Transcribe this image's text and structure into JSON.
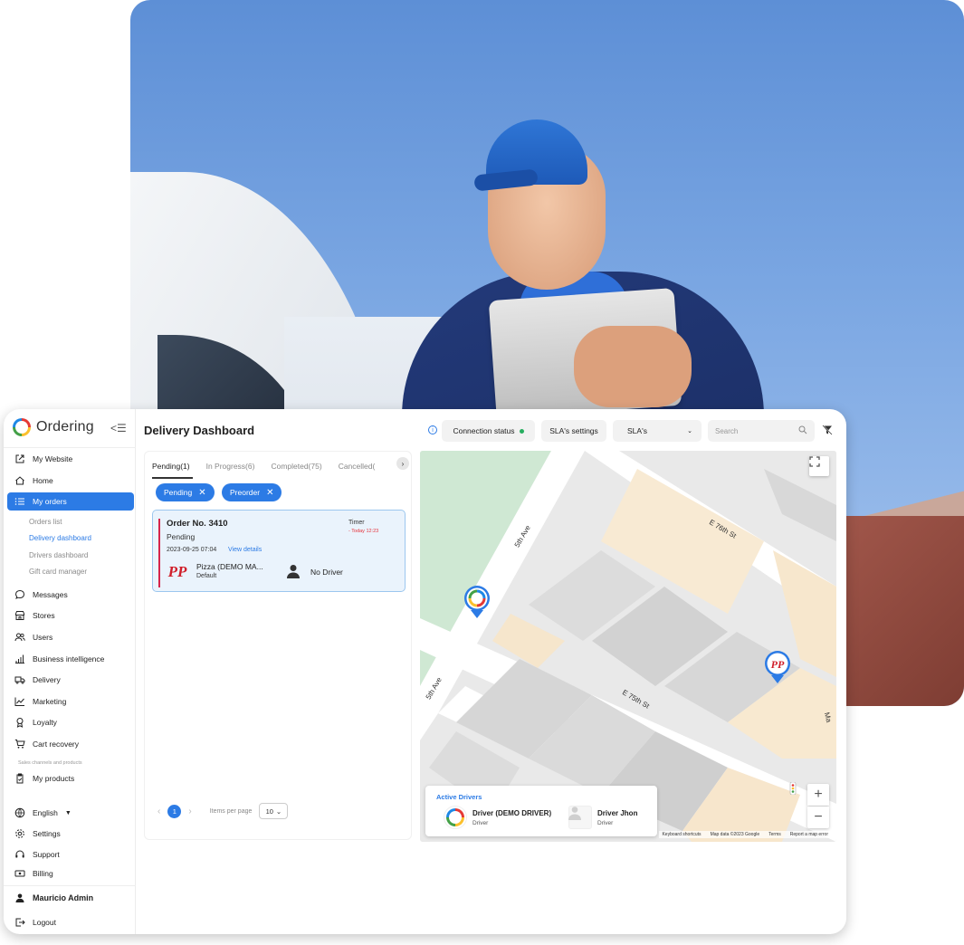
{
  "sidebar": {
    "brand": "Ordering",
    "items": [
      {
        "label": "My Website"
      },
      {
        "label": "Home"
      },
      {
        "label": "My orders"
      },
      {
        "label": "Messages"
      },
      {
        "label": "Stores"
      },
      {
        "label": "Users"
      },
      {
        "label": "Business intelligence"
      },
      {
        "label": "Delivery"
      },
      {
        "label": "Marketing"
      },
      {
        "label": "Loyalty"
      },
      {
        "label": "Cart recovery"
      },
      {
        "label": "My products"
      },
      {
        "label": "English"
      },
      {
        "label": "Settings"
      },
      {
        "label": "Support"
      },
      {
        "label": "Billing"
      },
      {
        "label": "Logout"
      }
    ],
    "sub_items": [
      "Orders list",
      "Delivery dashboard",
      "Drivers dashboard",
      "Gift card manager"
    ],
    "section_caption": "Sales channels and products",
    "user": "Mauricio Admin"
  },
  "header": {
    "title": "Delivery Dashboard",
    "connection_status": "Connection status",
    "sla_settings": "SLA's settings",
    "sla_select": "SLA's",
    "search_placeholder": "Search"
  },
  "orders": {
    "tabs": [
      "Pending(1)",
      "In Progress(6)",
      "Completed(75)",
      "Cancelled("
    ],
    "chips": [
      "Pending",
      "Preorder"
    ],
    "card": {
      "order_no": "Order No. 3410",
      "status": "Pending",
      "date": "2023-09-25 07:04",
      "view_details": "View details",
      "timer_label": "Timer",
      "timer_value": "- Today 12:23",
      "store_name": "Pizza (DEMO MA...",
      "store_sub": "Default",
      "driver": "No Driver"
    },
    "pager": {
      "page": "1",
      "items_per_page_label": "Items per page",
      "per_page_value": "10"
    }
  },
  "map": {
    "streets": [
      "5th Ave",
      "E 76th St",
      "5th Ave",
      "E 75th St",
      "Ma"
    ],
    "footer": [
      "Keyboard shortcuts",
      "Map data ©2023 Google",
      "Terms",
      "Report a map error"
    ],
    "active_drivers_title": "Active Drivers",
    "drivers": [
      {
        "name": "Driver (DEMO DRIVER)",
        "role": "Driver"
      },
      {
        "name": "Driver Jhon",
        "role": "Driver"
      }
    ]
  },
  "colors": {
    "accent": "#2c7be5",
    "status_green": "#27ae60",
    "order_bar": "#d6244b"
  }
}
